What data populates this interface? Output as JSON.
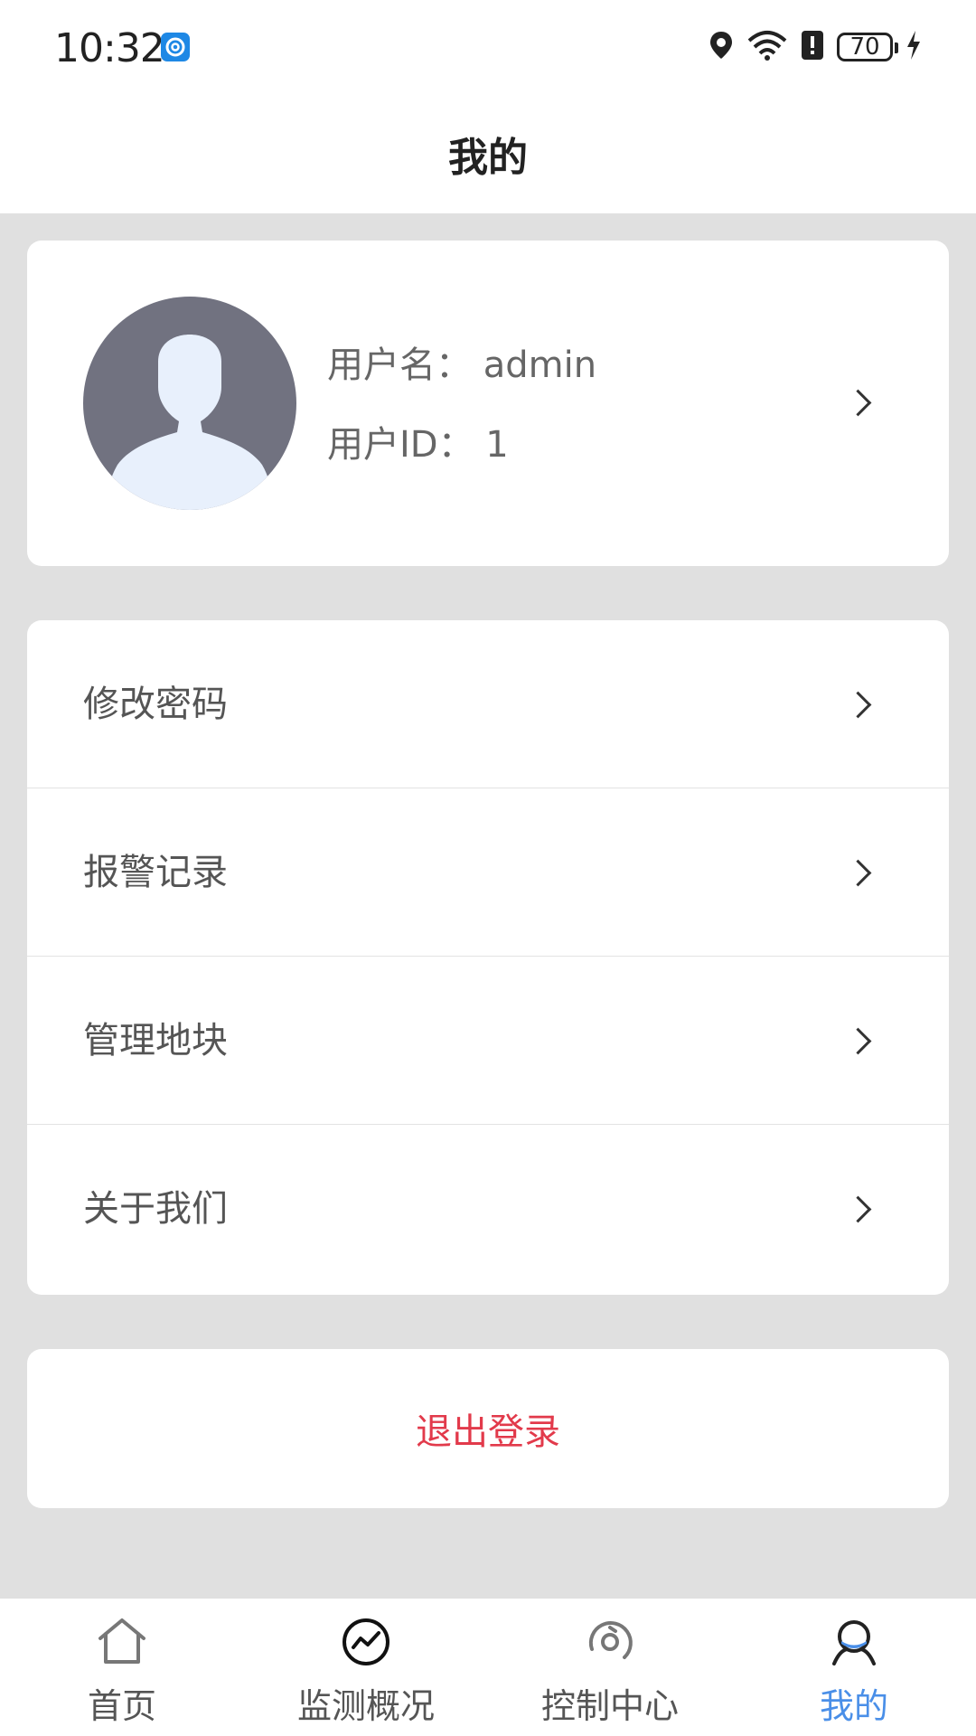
{
  "status_bar": {
    "time": "10:32",
    "battery_level": "70"
  },
  "header": {
    "title": "我的"
  },
  "profile": {
    "username_line": "用户名：  admin",
    "userid_line": "用户ID：  1"
  },
  "menu": {
    "items": [
      {
        "label": "修改密码"
      },
      {
        "label": "报警记录"
      },
      {
        "label": "管理地块"
      },
      {
        "label": "关于我们"
      }
    ]
  },
  "logout": {
    "label": "退出登录",
    "color": "#e23a4b"
  },
  "tabbar": {
    "active_color": "#4a8fe8",
    "tabs": [
      {
        "label": "首页",
        "icon": "home-icon"
      },
      {
        "label": "监测概况",
        "icon": "monitor-icon"
      },
      {
        "label": "控制中心",
        "icon": "control-icon"
      },
      {
        "label": "我的",
        "icon": "user-icon"
      }
    ]
  }
}
